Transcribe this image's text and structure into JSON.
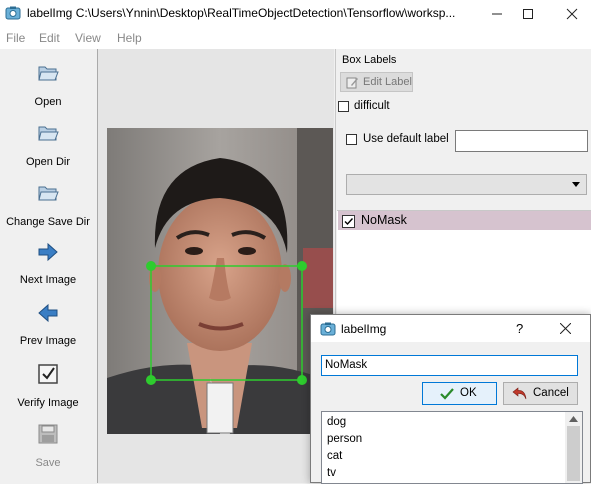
{
  "window": {
    "title": "labelImg C:\\Users\\Ynnin\\Desktop\\RealTimeObjectDetection\\Tensorflow\\worksp...",
    "icon": "labelimg-app-icon"
  },
  "menu": [
    "File",
    "Edit",
    "View",
    "Help"
  ],
  "toolbar": {
    "items": [
      {
        "label": "Open",
        "icon": "folder-open-icon",
        "enabled": true
      },
      {
        "label": "Open Dir",
        "icon": "folder-open-icon",
        "enabled": true
      },
      {
        "label": "Change Save Dir",
        "icon": "folder-open-icon",
        "enabled": true
      },
      {
        "label": "Next Image",
        "icon": "arrow-right-icon",
        "enabled": true
      },
      {
        "label": "Prev Image",
        "icon": "arrow-left-icon",
        "enabled": true
      },
      {
        "label": "Verify Image",
        "icon": "check-icon",
        "enabled": true
      },
      {
        "label": "Save",
        "icon": "save-icon",
        "enabled": false
      }
    ]
  },
  "box_labels": {
    "title": "Box Labels",
    "edit_label": "Edit Label",
    "difficult": "difficult",
    "use_default_label": "Use default label",
    "default_label_value": "",
    "dropdown_value": "",
    "labels": [
      {
        "name": "NoMask",
        "checked": true,
        "selected": true
      }
    ]
  },
  "dialog": {
    "title": "labelImg",
    "help_symbol": "?",
    "input_value": "NoMask",
    "ok_label": "OK",
    "cancel_label": "Cancel",
    "options": [
      "dog",
      "person",
      "cat",
      "tv"
    ]
  },
  "colors": {
    "accent_selection": "#d6c3cf",
    "bbox_green": "#2ecc2e",
    "dialog_focus_blue": "#0078d7",
    "ok_check_green": "#2a8a2a",
    "cancel_undo_red": "#c0392b"
  }
}
